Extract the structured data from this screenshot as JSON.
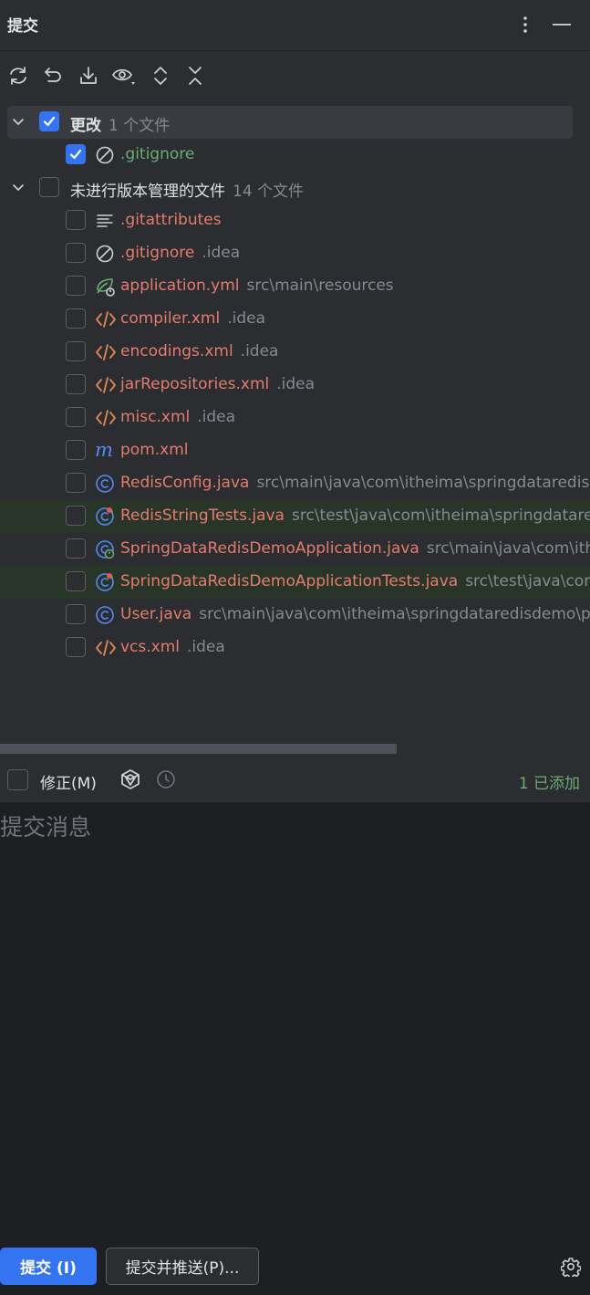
{
  "header": {
    "title": "提交"
  },
  "groups": [
    {
      "name": "更改",
      "count": "1 个文件",
      "files": [
        {
          "name": ".gitignore",
          "location": "",
          "icon": "gitignore-icon",
          "color": "green",
          "checked": true
        }
      ]
    },
    {
      "name": "未进行版本管理的文件",
      "count": "14 个文件",
      "files": [
        {
          "name": ".gitattributes",
          "location": "",
          "icon": "text-file-icon",
          "color": "red",
          "checked": false
        },
        {
          "name": ".gitignore",
          "location": ".idea",
          "icon": "gitignore-icon",
          "color": "red",
          "checked": false
        },
        {
          "name": "application.yml",
          "location": "src\\main\\resources",
          "icon": "spring-config-icon",
          "color": "red",
          "checked": false
        },
        {
          "name": "compiler.xml",
          "location": ".idea",
          "icon": "xml-icon",
          "color": "red",
          "checked": false
        },
        {
          "name": "encodings.xml",
          "location": ".idea",
          "icon": "xml-icon",
          "color": "red",
          "checked": false
        },
        {
          "name": "jarRepositories.xml",
          "location": ".idea",
          "icon": "xml-icon",
          "color": "red",
          "checked": false
        },
        {
          "name": "misc.xml",
          "location": ".idea",
          "icon": "xml-icon",
          "color": "red",
          "checked": false
        },
        {
          "name": "pom.xml",
          "location": "",
          "icon": "maven-icon",
          "color": "red",
          "checked": false
        },
        {
          "name": "RedisConfig.java",
          "location": "src\\main\\java\\com\\itheima\\springdataredisdemo\\config",
          "icon": "java-class-icon",
          "color": "red",
          "checked": false
        },
        {
          "name": "RedisStringTests.java",
          "location": "src\\test\\java\\com\\itheima\\springdataredisdemo",
          "icon": "java-test-class-icon",
          "color": "red",
          "checked": false,
          "highlight": true
        },
        {
          "name": "SpringDataRedisDemoApplication.java",
          "location": "src\\main\\java\\com\\itheima\\springdataredisdemo",
          "icon": "spring-boot-class-icon",
          "color": "red",
          "checked": false
        },
        {
          "name": "SpringDataRedisDemoApplicationTests.java",
          "location": "src\\test\\java\\com\\itheima\\springdataredisdemo",
          "icon": "java-test-class-icon",
          "color": "red",
          "checked": false,
          "highlight": true
        },
        {
          "name": "User.java",
          "location": "src\\main\\java\\com\\itheima\\springdataredisdemo\\pojo",
          "icon": "java-class-icon",
          "color": "red",
          "checked": false
        },
        {
          "name": "vcs.xml",
          "location": ".idea",
          "icon": "xml-icon",
          "color": "red",
          "checked": false
        }
      ]
    }
  ],
  "amend": {
    "label": "修正(M)",
    "added": "1 已添加"
  },
  "message": {
    "placeholder": "提交消息"
  },
  "actions": {
    "commit": "提交 (I)",
    "commit_push": "提交并推送(P)..."
  },
  "colors": {
    "accent": "#3574f0",
    "added_green": "#6aab73",
    "unversioned_red": "#e47c6e"
  }
}
